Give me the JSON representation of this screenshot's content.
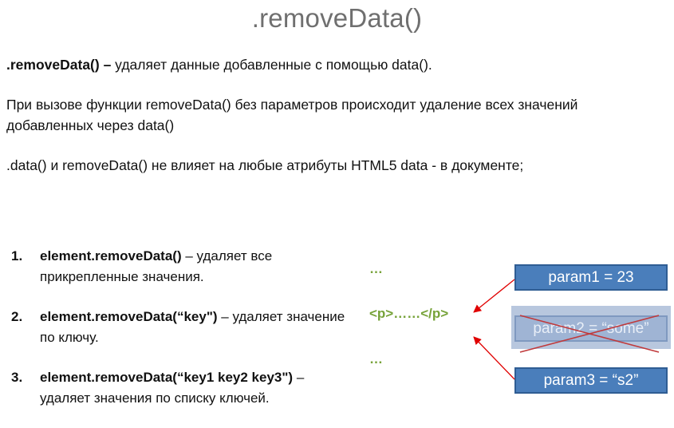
{
  "title": ".removeData()",
  "p1": {
    "bold": ".removeData() –",
    "text": " удаляет данные добавленные с помощью data()."
  },
  "p2": "При вызове функции removeData() без параметров происходит удаление всех значений добавленных через data()",
  "p3": ".data() и removeData() не влияет на любые атрибуты HTML5 data - в документе;",
  "list": [
    {
      "num": "1.",
      "code": "element.removeData()",
      "text": " – удаляет все прикрепленные значения."
    },
    {
      "num": "2.",
      "code": "element.removeData(“key\")",
      "text": " – удаляет значение по ключу."
    },
    {
      "num": "3.",
      "code": "element.removeData(“key1 key2 key3\")",
      "text": " – удаляет значения по списку ключей."
    }
  ],
  "snippet": {
    "dots_top": "…",
    "p_tag": "<p>……</p>",
    "dots_bottom": "…"
  },
  "boxes": {
    "param1": "param1 = 23",
    "param2": "param2 = “some”",
    "param3": "param3 = “s2”"
  },
  "colors": {
    "title": "#6f6f6f",
    "code_green": "#77a33a",
    "box_fill": "#4a7ebb",
    "box_removed_fill": "#9fb4d4",
    "arrow_red": "#e00000"
  }
}
